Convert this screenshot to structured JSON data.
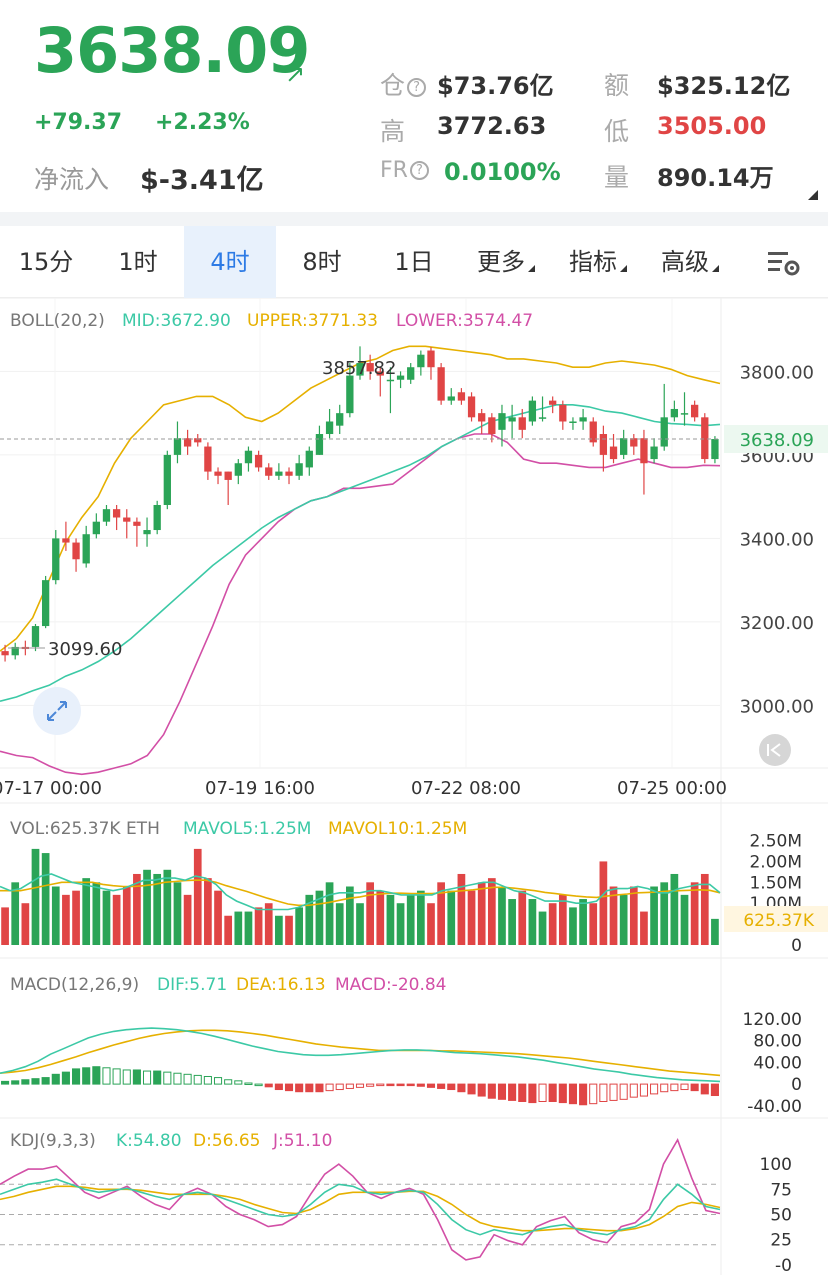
{
  "header": {
    "price": "3638.09",
    "change_abs": "+79.37",
    "change_pct": "+2.23%",
    "netflow_label": "净流入",
    "netflow_value": "$-3.41亿",
    "stats": {
      "oi_label": "仓",
      "oi_value": "$73.76亿",
      "amount_label": "额",
      "amount_value": "$325.12亿",
      "high_label": "高",
      "high_value": "3772.63",
      "low_label": "低",
      "low_value": "3505.00",
      "fr_label": "FR",
      "fr_value": "0.0100%",
      "volume_label": "量",
      "volume_value": "890.14万"
    }
  },
  "tabs": [
    "15分",
    "1时",
    "4时",
    "8时",
    "1日",
    "更多",
    "指标",
    "高级"
  ],
  "active_tab": "4时",
  "colors": {
    "up": "#2ba457",
    "down": "#e04545",
    "mid": "#3cc9a6",
    "upper": "#e6b000",
    "lower": "#d24fa6",
    "dea": "#e6b000"
  },
  "chart_data": [
    {
      "type": "candlestick",
      "indicator": {
        "name": "BOLL(20,2)",
        "mid_label": "MID:3672.90",
        "upper_label": "UPPER:3771.33",
        "lower_label": "LOWER:3574.47"
      },
      "ylim": [
        2850,
        3880
      ],
      "y_ticks": [
        "3800.00",
        "3600.00",
        "3400.00",
        "3200.00",
        "3000.00"
      ],
      "current_price_label": "3638.09",
      "max_label": "3857.82",
      "min_label": "3099.60",
      "x_ticks": [
        "07-17 00:00",
        "07-19 16:00",
        "07-22 08:00",
        "07-25 00:00"
      ],
      "candles": [
        [
          3130,
          3120,
          3145,
          3105
        ],
        [
          3120,
          3140,
          3150,
          3110
        ],
        [
          3140,
          3135,
          3155,
          3120
        ],
        [
          3140,
          3190,
          3195,
          3130
        ],
        [
          3190,
          3300,
          3310,
          3185
        ],
        [
          3300,
          3400,
          3420,
          3290
        ],
        [
          3400,
          3390,
          3440,
          3370
        ],
        [
          3390,
          3350,
          3400,
          3320
        ],
        [
          3340,
          3410,
          3430,
          3330
        ],
        [
          3410,
          3440,
          3460,
          3400
        ],
        [
          3440,
          3470,
          3480,
          3430
        ],
        [
          3470,
          3450,
          3480,
          3420
        ],
        [
          3450,
          3440,
          3470,
          3400
        ],
        [
          3440,
          3430,
          3450,
          3380
        ],
        [
          3410,
          3420,
          3450,
          3380
        ],
        [
          3420,
          3480,
          3490,
          3410
        ],
        [
          3480,
          3600,
          3610,
          3470
        ],
        [
          3600,
          3640,
          3680,
          3580
        ],
        [
          3640,
          3620,
          3660,
          3600
        ],
        [
          3640,
          3630,
          3650,
          3620
        ],
        [
          3620,
          3560,
          3630,
          3540
        ],
        [
          3560,
          3550,
          3570,
          3530
        ],
        [
          3560,
          3540,
          3560,
          3480
        ],
        [
          3550,
          3580,
          3590,
          3530
        ],
        [
          3580,
          3610,
          3620,
          3560
        ],
        [
          3600,
          3570,
          3610,
          3560
        ],
        [
          3570,
          3550,
          3580,
          3540
        ],
        [
          3550,
          3560,
          3580,
          3540
        ],
        [
          3560,
          3550,
          3570,
          3530
        ],
        [
          3550,
          3580,
          3600,
          3540
        ],
        [
          3570,
          3610,
          3620,
          3550
        ],
        [
          3600,
          3650,
          3670,
          3600
        ],
        [
          3650,
          3680,
          3710,
          3640
        ],
        [
          3670,
          3700,
          3720,
          3650
        ],
        [
          3700,
          3790,
          3820,
          3690
        ],
        [
          3790,
          3820,
          3860,
          3780
        ],
        [
          3820,
          3800,
          3840,
          3780
        ],
        [
          3800,
          3790,
          3810,
          3740
        ],
        [
          3780,
          3780,
          3810,
          3700
        ],
        [
          3780,
          3790,
          3800,
          3760
        ],
        [
          3780,
          3810,
          3820,
          3770
        ],
        [
          3810,
          3840,
          3850,
          3790
        ],
        [
          3850,
          3810,
          3858,
          3780
        ],
        [
          3810,
          3730,
          3820,
          3720
        ],
        [
          3730,
          3740,
          3760,
          3720
        ],
        [
          3750,
          3730,
          3760,
          3720
        ],
        [
          3740,
          3690,
          3750,
          3680
        ],
        [
          3700,
          3680,
          3710,
          3650
        ],
        [
          3690,
          3650,
          3700,
          3630
        ],
        [
          3660,
          3700,
          3720,
          3620
        ],
        [
          3680,
          3690,
          3720,
          3640
        ],
        [
          3690,
          3660,
          3710,
          3640
        ],
        [
          3680,
          3730,
          3740,
          3670
        ],
        [
          3690,
          3690,
          3740,
          3680
        ],
        [
          3730,
          3720,
          3740,
          3700
        ],
        [
          3720,
          3680,
          3730,
          3660
        ],
        [
          3680,
          3680,
          3690,
          3660
        ],
        [
          3680,
          3690,
          3710,
          3660
        ],
        [
          3680,
          3630,
          3690,
          3620
        ],
        [
          3650,
          3600,
          3670,
          3560
        ],
        [
          3620,
          3590,
          3650,
          3580
        ],
        [
          3600,
          3640,
          3660,
          3590
        ],
        [
          3640,
          3620,
          3650,
          3600
        ],
        [
          3640,
          3580,
          3660,
          3505
        ],
        [
          3590,
          3620,
          3640,
          3580
        ],
        [
          3620,
          3690,
          3770,
          3610
        ],
        [
          3690,
          3710,
          3730,
          3680
        ],
        [
          3700,
          3700,
          3750,
          3670
        ],
        [
          3720,
          3690,
          3730,
          3680
        ],
        [
          3690,
          3590,
          3700,
          3580
        ],
        [
          3590,
          3638,
          3645,
          3580
        ]
      ],
      "mid_line": [
        3010,
        3020,
        3035,
        3048,
        3070,
        3085,
        3105,
        3130,
        3160,
        3195,
        3230,
        3265,
        3300,
        3335,
        3365,
        3395,
        3425,
        3450,
        3470,
        3490,
        3500,
        3515,
        3530,
        3545,
        3560,
        3575,
        3595,
        3620,
        3640,
        3660,
        3680,
        3690,
        3700,
        3710,
        3720,
        3720,
        3715,
        3705,
        3700,
        3690,
        3680,
        3675,
        3673,
        3670,
        3673
      ],
      "upper_line": [
        3130,
        3160,
        3210,
        3300,
        3390,
        3450,
        3500,
        3580,
        3640,
        3680,
        3720,
        3730,
        3740,
        3740,
        3720,
        3690,
        3680,
        3700,
        3730,
        3760,
        3780,
        3800,
        3820,
        3830,
        3850,
        3860,
        3860,
        3855,
        3850,
        3845,
        3840,
        3830,
        3830,
        3825,
        3820,
        3810,
        3810,
        3820,
        3825,
        3820,
        3815,
        3805,
        3790,
        3780,
        3771
      ],
      "lower_line": [
        2890,
        2880,
        2875,
        2855,
        2840,
        2835,
        2840,
        2850,
        2860,
        2880,
        2930,
        3010,
        3100,
        3190,
        3290,
        3360,
        3400,
        3440,
        3470,
        3490,
        3500,
        3520,
        3520,
        3525,
        3530,
        3560,
        3590,
        3620,
        3640,
        3650,
        3650,
        3630,
        3590,
        3580,
        3580,
        3575,
        3570,
        3570,
        3580,
        3590,
        3580,
        3570,
        3570,
        3575,
        3574
      ]
    },
    {
      "type": "bar",
      "indicator": {
        "name": "VOL:625.37K ETH",
        "mavol5_label": "MAVOL5:1.25M",
        "mavol10_label": "MAVOL10:1.25M"
      },
      "ylim": [
        0,
        2800000
      ],
      "y_ticks": [
        "2.50M",
        "2.00M",
        "1.50M",
        "1.00M",
        "0"
      ],
      "current_label": "625.37K",
      "values": [
        900000,
        1500000,
        1000000,
        2300000,
        2200000,
        1400000,
        1200000,
        1300000,
        1600000,
        1500000,
        1300000,
        1200000,
        1400000,
        1700000,
        1800000,
        1700000,
        1800000,
        1500000,
        1200000,
        2300000,
        1600000,
        1300000,
        700000,
        800000,
        800000,
        900000,
        1000000,
        700000,
        700000,
        900000,
        1200000,
        1300000,
        1500000,
        1000000,
        1400000,
        1000000,
        1500000,
        1300000,
        1200000,
        1000000,
        1200000,
        1300000,
        1000000,
        1500000,
        1300000,
        1700000,
        1300000,
        1500000,
        1600000,
        1400000,
        1100000,
        1300000,
        1100000,
        800000,
        1000000,
        1200000,
        900000,
        1100000,
        1000000,
        2000000,
        1400000,
        1200000,
        1400000,
        800000,
        1400000,
        1500000,
        1700000,
        1200000,
        1500000,
        1700000,
        625370
      ],
      "mavol5": [
        1400000,
        1300000,
        1350000,
        1500000,
        1650000,
        1700000,
        1600000,
        1500000,
        1450000,
        1400000,
        1350000,
        1300000,
        1350000,
        1450000,
        1550000,
        1550000,
        1600000,
        1600000,
        1550000,
        1650000,
        1600000,
        1450000,
        1200000,
        1050000,
        950000,
        850000,
        850000,
        850000,
        850000,
        900000,
        1000000,
        1100000,
        1200000,
        1250000,
        1250000,
        1250000,
        1300000,
        1300000,
        1250000,
        1200000,
        1200000,
        1200000,
        1200000,
        1300000,
        1350000,
        1400000,
        1450000,
        1500000,
        1500000,
        1400000,
        1300000,
        1250000,
        1150000,
        1050000,
        1050000,
        1050000,
        1000000,
        1000000,
        1050000,
        1300000,
        1350000,
        1350000,
        1400000,
        1350000,
        1250000,
        1250000,
        1350000,
        1400000,
        1450000,
        1450000,
        1250000
      ],
      "mavol10": [
        1300000,
        1300000,
        1300000,
        1350000,
        1400000,
        1450000,
        1500000,
        1500000,
        1500000,
        1500000,
        1450000,
        1420000,
        1400000,
        1400000,
        1420000,
        1450000,
        1500000,
        1520000,
        1540000,
        1550000,
        1550000,
        1500000,
        1420000,
        1350000,
        1280000,
        1200000,
        1120000,
        1050000,
        980000,
        950000,
        950000,
        980000,
        1020000,
        1070000,
        1120000,
        1150000,
        1200000,
        1220000,
        1240000,
        1240000,
        1230000,
        1230000,
        1230000,
        1250000,
        1280000,
        1300000,
        1320000,
        1350000,
        1380000,
        1380000,
        1360000,
        1330000,
        1300000,
        1260000,
        1230000,
        1200000,
        1170000,
        1150000,
        1140000,
        1170000,
        1200000,
        1220000,
        1250000,
        1260000,
        1270000,
        1290000,
        1300000,
        1310000,
        1320000,
        1310000,
        1250000
      ]
    },
    {
      "type": "bar",
      "indicator": {
        "name": "MACD(12,26,9)",
        "dif_label": "DIF:5.71",
        "dea_label": "DEA:16.13",
        "macd_label": "MACD:-20.84"
      },
      "ylim": [
        -55,
        140
      ],
      "y_ticks": [
        "120.00",
        "80.00",
        "40.00",
        "0",
        "-40.00"
      ],
      "hist": [
        5,
        6,
        8,
        10,
        12,
        18,
        22,
        28,
        30,
        32,
        30,
        28,
        26,
        26,
        24,
        24,
        22,
        20,
        18,
        16,
        14,
        12,
        8,
        6,
        2,
        0,
        -5,
        -10,
        -12,
        -14,
        -14,
        -14,
        -12,
        -10,
        -8,
        -6,
        -4,
        -2,
        -2,
        -2,
        -2,
        -4,
        -6,
        -8,
        -10,
        -14,
        -18,
        -22,
        -26,
        -28,
        -30,
        -32,
        -34,
        -32,
        -32,
        -34,
        -36,
        -38,
        -36,
        -32,
        -30,
        -28,
        -24,
        -22,
        -18,
        -14,
        -12,
        -10,
        -12,
        -18,
        -21
      ],
      "dif": [
        20,
        25,
        32,
        42,
        55,
        65,
        75,
        85,
        92,
        97,
        100,
        102,
        103,
        102,
        100,
        97,
        93,
        88,
        82,
        76,
        70,
        65,
        60,
        57,
        54,
        53,
        53,
        54,
        56,
        58,
        60,
        62,
        63,
        63,
        62,
        60,
        58,
        57,
        56,
        54,
        52,
        50,
        47,
        44,
        40,
        36,
        32,
        28,
        25,
        22,
        18,
        15,
        12,
        10,
        8,
        7,
        6,
        5
      ],
      "dea": [
        20,
        22,
        25,
        30,
        36,
        43,
        50,
        58,
        65,
        72,
        78,
        84,
        89,
        93,
        96,
        98,
        99,
        99,
        98,
        96,
        93,
        90,
        86,
        82,
        78,
        74,
        71,
        68,
        66,
        64,
        62,
        62,
        62,
        62,
        62,
        61,
        61,
        60,
        59,
        58,
        57,
        56,
        54,
        52,
        50,
        48,
        45,
        42,
        39,
        36,
        33,
        30,
        27,
        24,
        22,
        20,
        18,
        16
      ]
    },
    {
      "type": "line",
      "indicator": {
        "name": "KDJ(9,3,3)",
        "k_label": "K:54.80",
        "d_label": "D:56.65",
        "j_label": "J:51.10"
      },
      "ylim": [
        -5,
        110
      ],
      "y_ticks": [
        "100",
        "75",
        "50",
        "25",
        "-0"
      ],
      "k": [
        70,
        75,
        80,
        82,
        85,
        80,
        75,
        72,
        74,
        76,
        72,
        68,
        65,
        70,
        72,
        70,
        65,
        60,
        55,
        50,
        48,
        50,
        60,
        72,
        80,
        78,
        72,
        70,
        72,
        74,
        72,
        60,
        45,
        35,
        30,
        35,
        32,
        30,
        35,
        38,
        40,
        35,
        32,
        30,
        35,
        38,
        45,
        65,
        80,
        70,
        58,
        55
      ],
      "d": [
        65,
        68,
        72,
        75,
        78,
        78,
        77,
        75,
        75,
        75,
        74,
        72,
        70,
        70,
        70,
        70,
        68,
        65,
        60,
        56,
        52,
        51,
        55,
        62,
        70,
        72,
        72,
        72,
        72,
        73,
        73,
        68,
        60,
        50,
        42,
        38,
        36,
        34,
        34,
        35,
        36,
        36,
        35,
        34,
        34,
        36,
        40,
        48,
        58,
        62,
        60,
        57
      ],
      "j": [
        80,
        88,
        95,
        95,
        98,
        85,
        72,
        66,
        72,
        78,
        68,
        60,
        55,
        70,
        76,
        70,
        58,
        50,
        45,
        38,
        40,
        48,
        70,
        90,
        100,
        88,
        72,
        66,
        72,
        76,
        70,
        45,
        15,
        5,
        8,
        30,
        24,
        20,
        38,
        44,
        48,
        32,
        25,
        22,
        38,
        42,
        55,
        100,
        124,
        86,
        54,
        51
      ]
    }
  ]
}
